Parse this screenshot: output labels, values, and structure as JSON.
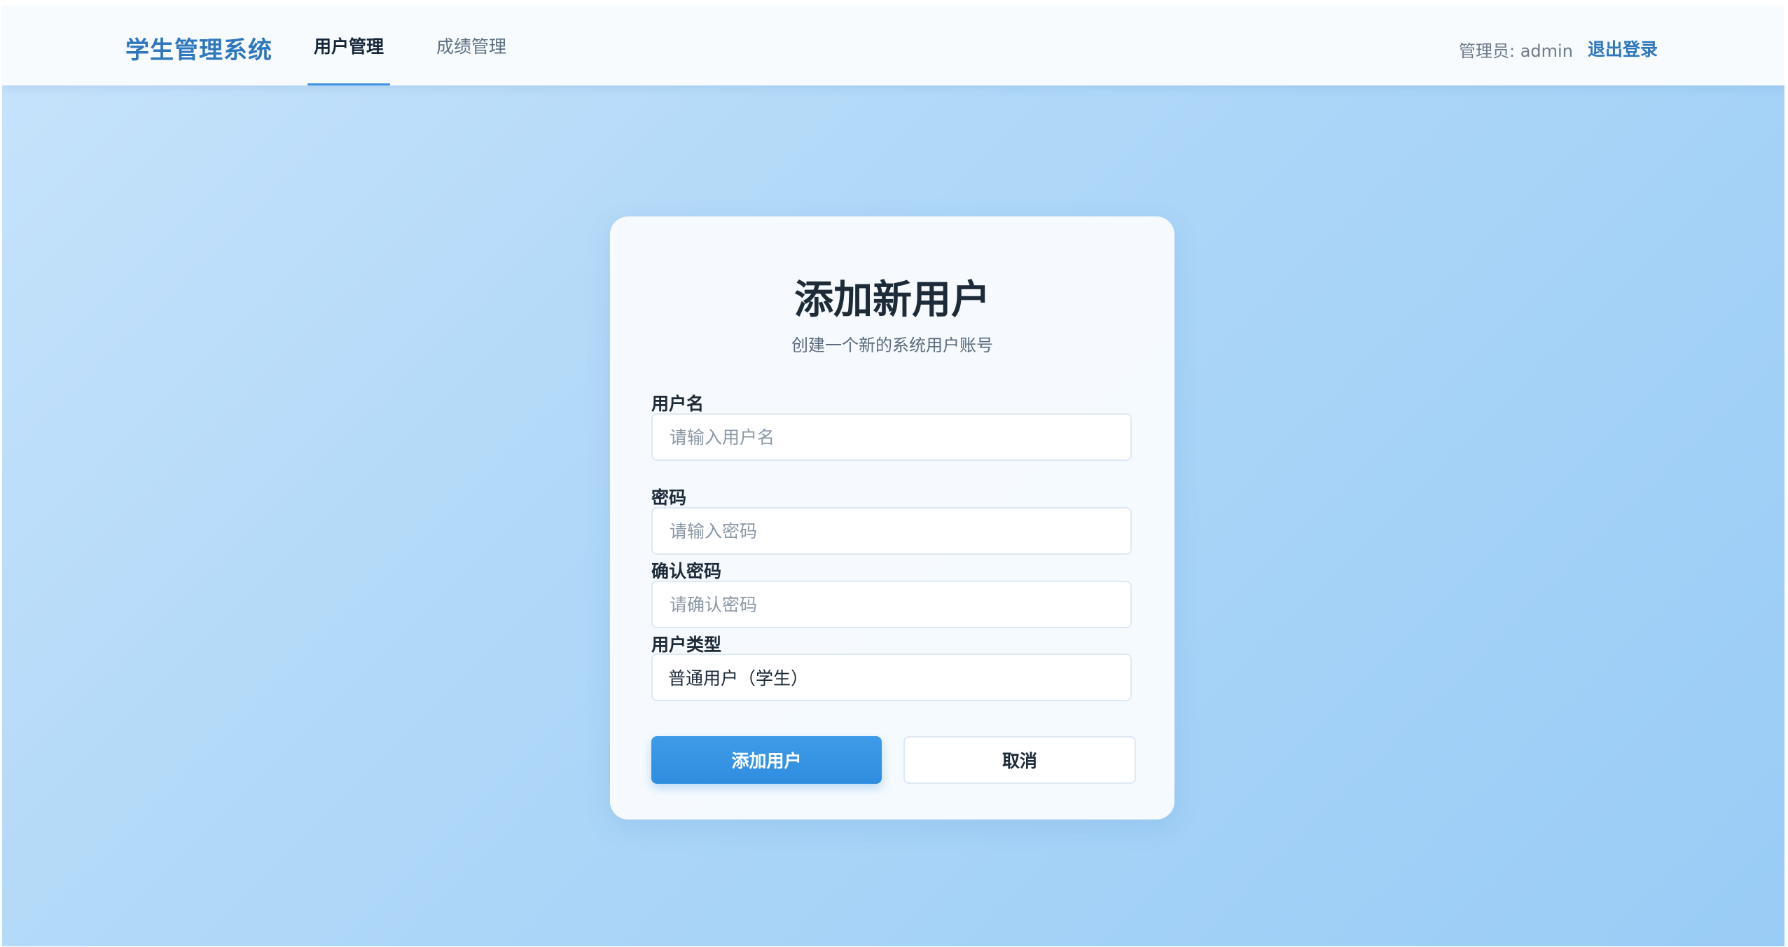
{
  "header": {
    "brand": "学生管理系统",
    "tabs": [
      {
        "label": "用户管理",
        "active": true
      },
      {
        "label": "成绩管理",
        "active": false
      }
    ],
    "admin_label": "管理员: admin",
    "logout_label": "退出登录"
  },
  "form": {
    "title": "添加新用户",
    "subtitle": "创建一个新的系统用户账号",
    "fields": [
      {
        "label": "用户名",
        "placeholder": "请输入用户名",
        "value": ""
      },
      {
        "label": "密码",
        "placeholder": "请输入密码",
        "value": ""
      },
      {
        "label": "确认密码",
        "placeholder": "请确认密码",
        "value": ""
      },
      {
        "label": "用户类型",
        "selected": "普通用户（学生）"
      }
    ],
    "submit_label": "添加用户",
    "cancel_label": "取消"
  },
  "colors": {
    "accent": "#2e77bd",
    "primary_button": "#3596e4",
    "background_start": "#c7e3fb",
    "background_end": "#99ccf6"
  }
}
